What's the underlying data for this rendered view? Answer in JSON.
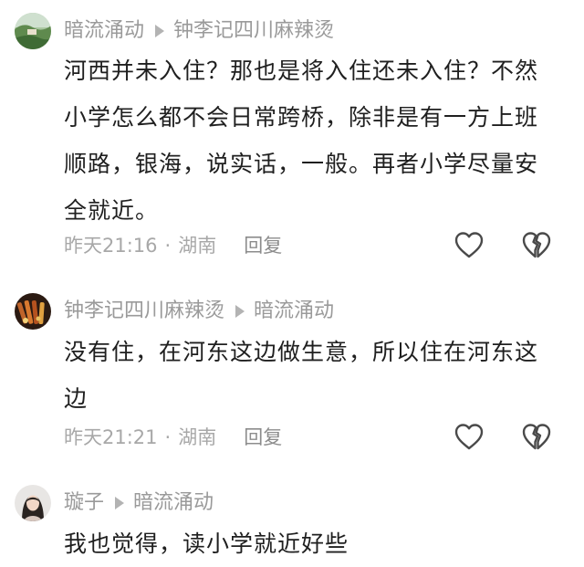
{
  "comments": [
    {
      "author": "暗流涌动",
      "reply_to": "钟李记四川麻辣烫",
      "text": "河西并未入住？那也是将入住还未入住？不然小学怎么都不会日常跨桥，除非是有一方上班顺路，银海，说实话，一般。再者小学尽量安全就近。",
      "time": "昨天21:16",
      "location": "湖南",
      "reply_label": "回复"
    },
    {
      "author": "钟李记四川麻辣烫",
      "reply_to": "暗流涌动",
      "text": "没有住，在河东这边做生意，所以住在河东这边",
      "time": "昨天21:21",
      "location": "湖南",
      "reply_label": "回复"
    },
    {
      "author": "璇子",
      "reply_to": "暗流涌动",
      "text": "我也觉得，读小学就近好些"
    }
  ],
  "separator": "·",
  "icons": {
    "like": "heart-outline-icon",
    "dislike": "broken-heart-icon"
  },
  "colors": {
    "text": "#1f1f1f",
    "secondary": "#9a9a9a"
  }
}
